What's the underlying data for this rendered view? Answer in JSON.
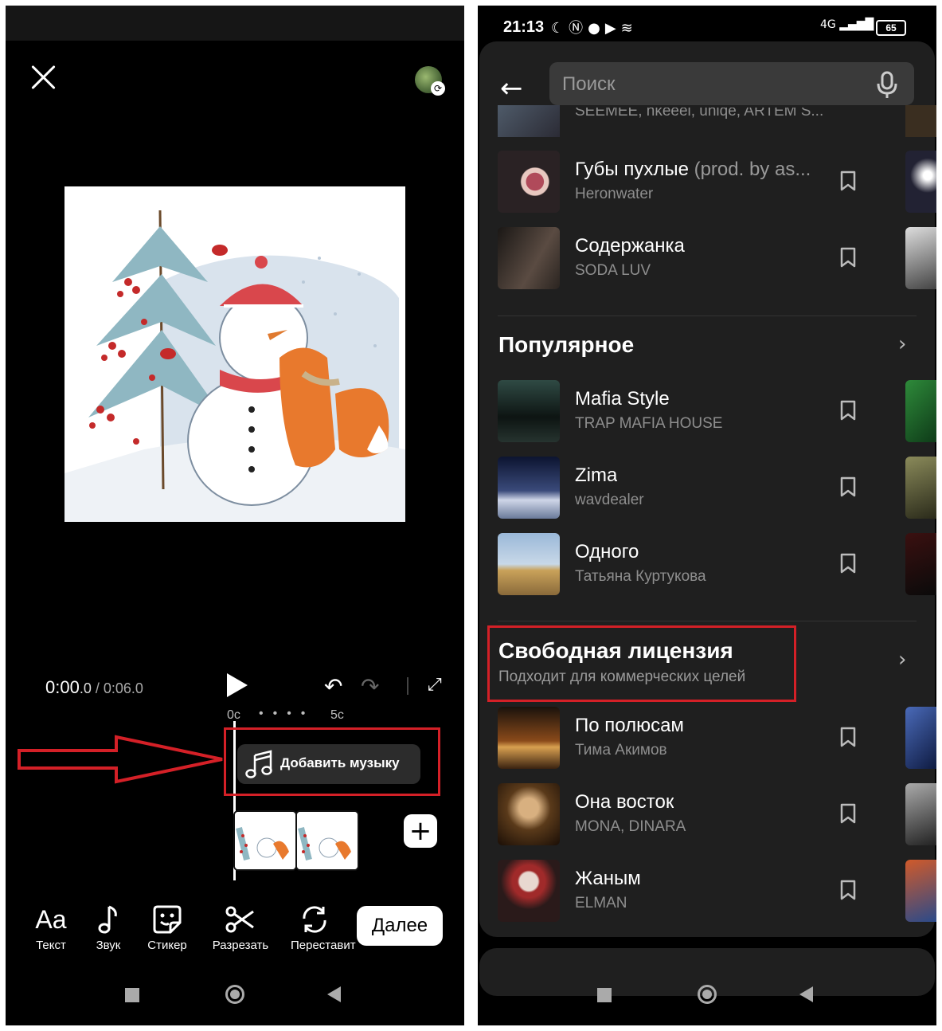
{
  "left": {
    "time_current": "0:00",
    "time_decimal": ".0",
    "time_total": " / 0:06.0",
    "tick_start": "0с",
    "tick_end": "5с",
    "add_music_label": "Добавить музыку",
    "plus_label": "+",
    "tools": [
      {
        "icon": "text-icon",
        "label": "Текст"
      },
      {
        "icon": "sound-icon",
        "label": "Звук"
      },
      {
        "icon": "sticker-icon",
        "label": "Стикер"
      },
      {
        "icon": "scissors-icon",
        "label": "Разрезать"
      },
      {
        "icon": "reorder-icon",
        "label": "Переставить"
      }
    ],
    "tool_text_glyph": "Aa",
    "next_label": "Далее"
  },
  "right": {
    "status_time": "21:13",
    "battery": "65",
    "network": "4G",
    "search_placeholder": "Поиск",
    "top_partial": {
      "artist": "SEEMEE, nkeeei, uniqe, ARTEM S..."
    },
    "top_tracks": [
      {
        "title": "Губы пухлые",
        "title_extra": " (prod. by as...",
        "artist": "Heronwater"
      },
      {
        "title": "Содержанка",
        "artist": "SODA LUV"
      }
    ],
    "popular": {
      "title": "Популярное",
      "tracks": [
        {
          "title": "Mafia Style",
          "artist": "TRAP MAFIA HOUSE"
        },
        {
          "title": "Zima",
          "artist": "wavdealer"
        },
        {
          "title": "Одного",
          "artist": "Татьяна Куртукова"
        }
      ]
    },
    "free_license": {
      "title": "Свободная лицензия",
      "subtitle": "Подходит для коммерческих целей",
      "tracks": [
        {
          "title": "По полюсам",
          "artist": "Тима Акимов"
        },
        {
          "title": "Она восток",
          "artist": "MONA, DINARA"
        },
        {
          "title": "Жаным",
          "artist": "ELMAN"
        }
      ]
    }
  },
  "colors": {
    "annotation_red": "#d42027",
    "sheet_bg": "#1f1f1f",
    "search_bg": "#3a3a3a"
  }
}
